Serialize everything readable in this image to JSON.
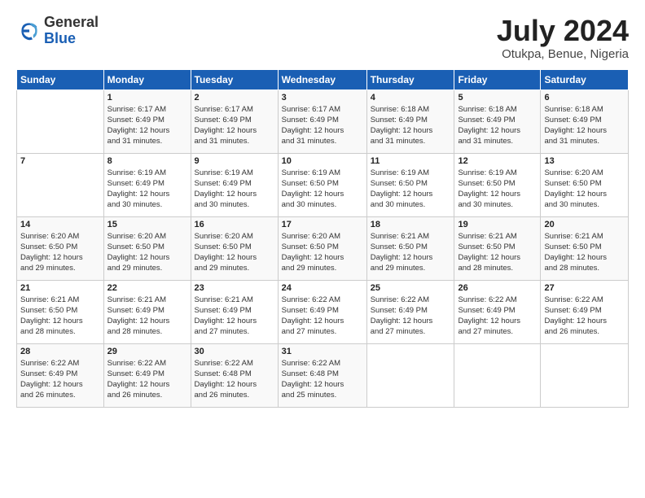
{
  "header": {
    "logo": {
      "general": "General",
      "blue": "Blue"
    },
    "title": "July 2024",
    "location": "Otukpa, Benue, Nigeria"
  },
  "weekdays": [
    "Sunday",
    "Monday",
    "Tuesday",
    "Wednesday",
    "Thursday",
    "Friday",
    "Saturday"
  ],
  "weeks": [
    [
      {
        "day": "",
        "info": ""
      },
      {
        "day": "1",
        "info": "Sunrise: 6:17 AM\nSunset: 6:49 PM\nDaylight: 12 hours\nand 31 minutes."
      },
      {
        "day": "2",
        "info": "Sunrise: 6:17 AM\nSunset: 6:49 PM\nDaylight: 12 hours\nand 31 minutes."
      },
      {
        "day": "3",
        "info": "Sunrise: 6:17 AM\nSunset: 6:49 PM\nDaylight: 12 hours\nand 31 minutes."
      },
      {
        "day": "4",
        "info": "Sunrise: 6:18 AM\nSunset: 6:49 PM\nDaylight: 12 hours\nand 31 minutes."
      },
      {
        "day": "5",
        "info": "Sunrise: 6:18 AM\nSunset: 6:49 PM\nDaylight: 12 hours\nand 31 minutes."
      },
      {
        "day": "6",
        "info": "Sunrise: 6:18 AM\nSunset: 6:49 PM\nDaylight: 12 hours\nand 31 minutes."
      }
    ],
    [
      {
        "day": "7",
        "info": ""
      },
      {
        "day": "8",
        "info": "Sunrise: 6:19 AM\nSunset: 6:49 PM\nDaylight: 12 hours\nand 30 minutes."
      },
      {
        "day": "9",
        "info": "Sunrise: 6:19 AM\nSunset: 6:49 PM\nDaylight: 12 hours\nand 30 minutes."
      },
      {
        "day": "10",
        "info": "Sunrise: 6:19 AM\nSunset: 6:50 PM\nDaylight: 12 hours\nand 30 minutes."
      },
      {
        "day": "11",
        "info": "Sunrise: 6:19 AM\nSunset: 6:50 PM\nDaylight: 12 hours\nand 30 minutes."
      },
      {
        "day": "12",
        "info": "Sunrise: 6:19 AM\nSunset: 6:50 PM\nDaylight: 12 hours\nand 30 minutes."
      },
      {
        "day": "13",
        "info": "Sunrise: 6:20 AM\nSunset: 6:50 PM\nDaylight: 12 hours\nand 30 minutes."
      }
    ],
    [
      {
        "day": "14",
        "info": "Sunrise: 6:20 AM\nSunset: 6:50 PM\nDaylight: 12 hours\nand 29 minutes."
      },
      {
        "day": "15",
        "info": "Sunrise: 6:20 AM\nSunset: 6:50 PM\nDaylight: 12 hours\nand 29 minutes."
      },
      {
        "day": "16",
        "info": "Sunrise: 6:20 AM\nSunset: 6:50 PM\nDaylight: 12 hours\nand 29 minutes."
      },
      {
        "day": "17",
        "info": "Sunrise: 6:20 AM\nSunset: 6:50 PM\nDaylight: 12 hours\nand 29 minutes."
      },
      {
        "day": "18",
        "info": "Sunrise: 6:21 AM\nSunset: 6:50 PM\nDaylight: 12 hours\nand 29 minutes."
      },
      {
        "day": "19",
        "info": "Sunrise: 6:21 AM\nSunset: 6:50 PM\nDaylight: 12 hours\nand 28 minutes."
      },
      {
        "day": "20",
        "info": "Sunrise: 6:21 AM\nSunset: 6:50 PM\nDaylight: 12 hours\nand 28 minutes."
      }
    ],
    [
      {
        "day": "21",
        "info": "Sunrise: 6:21 AM\nSunset: 6:50 PM\nDaylight: 12 hours\nand 28 minutes."
      },
      {
        "day": "22",
        "info": "Sunrise: 6:21 AM\nSunset: 6:49 PM\nDaylight: 12 hours\nand 28 minutes."
      },
      {
        "day": "23",
        "info": "Sunrise: 6:21 AM\nSunset: 6:49 PM\nDaylight: 12 hours\nand 27 minutes."
      },
      {
        "day": "24",
        "info": "Sunrise: 6:22 AM\nSunset: 6:49 PM\nDaylight: 12 hours\nand 27 minutes."
      },
      {
        "day": "25",
        "info": "Sunrise: 6:22 AM\nSunset: 6:49 PM\nDaylight: 12 hours\nand 27 minutes."
      },
      {
        "day": "26",
        "info": "Sunrise: 6:22 AM\nSunset: 6:49 PM\nDaylight: 12 hours\nand 27 minutes."
      },
      {
        "day": "27",
        "info": "Sunrise: 6:22 AM\nSunset: 6:49 PM\nDaylight: 12 hours\nand 26 minutes."
      }
    ],
    [
      {
        "day": "28",
        "info": "Sunrise: 6:22 AM\nSunset: 6:49 PM\nDaylight: 12 hours\nand 26 minutes."
      },
      {
        "day": "29",
        "info": "Sunrise: 6:22 AM\nSunset: 6:49 PM\nDaylight: 12 hours\nand 26 minutes."
      },
      {
        "day": "30",
        "info": "Sunrise: 6:22 AM\nSunset: 6:48 PM\nDaylight: 12 hours\nand 26 minutes."
      },
      {
        "day": "31",
        "info": "Sunrise: 6:22 AM\nSunset: 6:48 PM\nDaylight: 12 hours\nand 25 minutes."
      },
      {
        "day": "",
        "info": ""
      },
      {
        "day": "",
        "info": ""
      },
      {
        "day": "",
        "info": ""
      }
    ]
  ]
}
